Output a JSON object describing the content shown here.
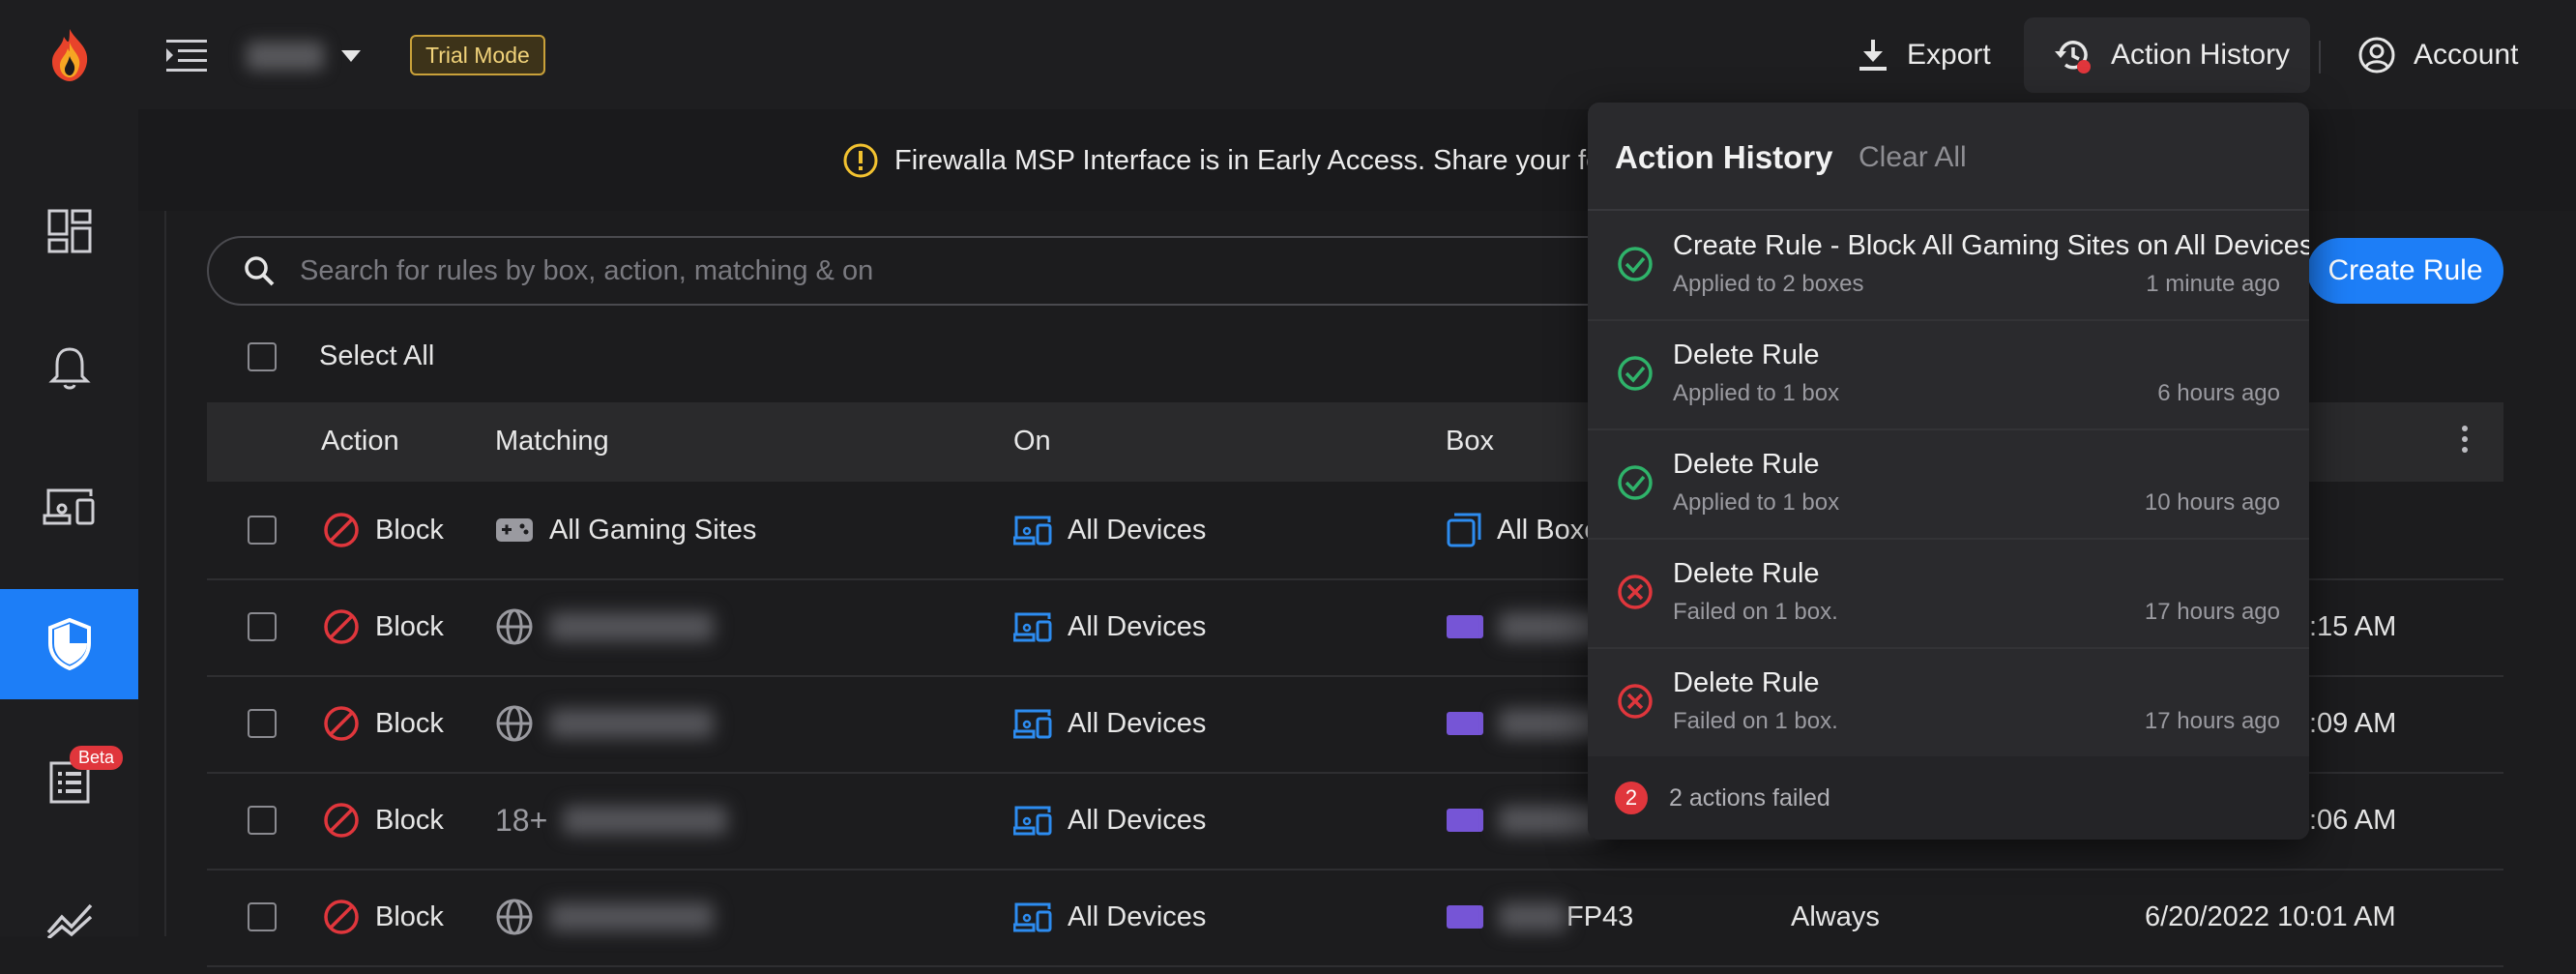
{
  "topbar": {
    "trial_label": "Trial Mode",
    "export_label": "Export",
    "action_history_label": "Action History",
    "account_label": "Account"
  },
  "sidebar": {
    "items": [
      {
        "icon": "dashboard-icon"
      },
      {
        "icon": "bell-icon"
      },
      {
        "icon": "devices-icon"
      },
      {
        "icon": "shield-icon",
        "active": true
      },
      {
        "icon": "logs-icon",
        "badge": "Beta"
      },
      {
        "icon": "trends-icon"
      }
    ]
  },
  "banner": {
    "text": "Firewalla MSP Interface is in Early Access. Share your feedback with u"
  },
  "search": {
    "placeholder": "Search for rules by box, action, matching & on"
  },
  "create_rule_label": "Create Rule",
  "select_all_label": "Select All",
  "table": {
    "headers": {
      "action": "Action",
      "matching": "Matching",
      "on": "On",
      "box": "Box"
    },
    "rows": [
      {
        "action": "Block",
        "matching": "All Gaming Sites",
        "on": "All Devices",
        "box": "All Boxe",
        "schedule": "",
        "time": ""
      },
      {
        "action": "Block",
        "matching": "",
        "on": "All Devices",
        "box": "",
        "schedule": "",
        "time": ":15 AM"
      },
      {
        "action": "Block",
        "matching": "",
        "on": "All Devices",
        "box": "",
        "schedule": "",
        "time": ":09 AM"
      },
      {
        "action": "Block",
        "matching_prefix": "18+",
        "matching": "",
        "on": "All Devices",
        "box": "",
        "schedule": "",
        "time": ":06 AM"
      },
      {
        "action": "Block",
        "matching": "",
        "on": "All Devices",
        "box": "FP43",
        "schedule": "Always",
        "time": "6/20/2022 10:01 AM"
      }
    ]
  },
  "action_history": {
    "title": "Action History",
    "clear_label": "Clear All",
    "items": [
      {
        "status": "success",
        "title": "Create Rule - Block All Gaming Sites on All Devices",
        "detail": "Applied to 2 boxes",
        "time": "1 minute ago"
      },
      {
        "status": "success",
        "title": "Delete Rule",
        "detail": "Applied to 1 box",
        "time": "6 hours ago"
      },
      {
        "status": "success",
        "title": "Delete Rule",
        "detail": "Applied to 1 box",
        "time": "10 hours ago"
      },
      {
        "status": "failed",
        "title": "Delete Rule",
        "detail": "Failed on 1 box.",
        "time": "17 hours ago"
      },
      {
        "status": "failed",
        "title": "Delete Rule",
        "detail": "Failed on 1 box.",
        "time": "17 hours ago"
      }
    ],
    "failed_count": "2",
    "failed_text": "2 actions failed"
  },
  "colors": {
    "accent": "#1d7ef7",
    "block_red": "#e0363c",
    "success_green": "#2fb36a",
    "device_blue": "#2d8cf0",
    "trial_border": "#c9a13a"
  }
}
